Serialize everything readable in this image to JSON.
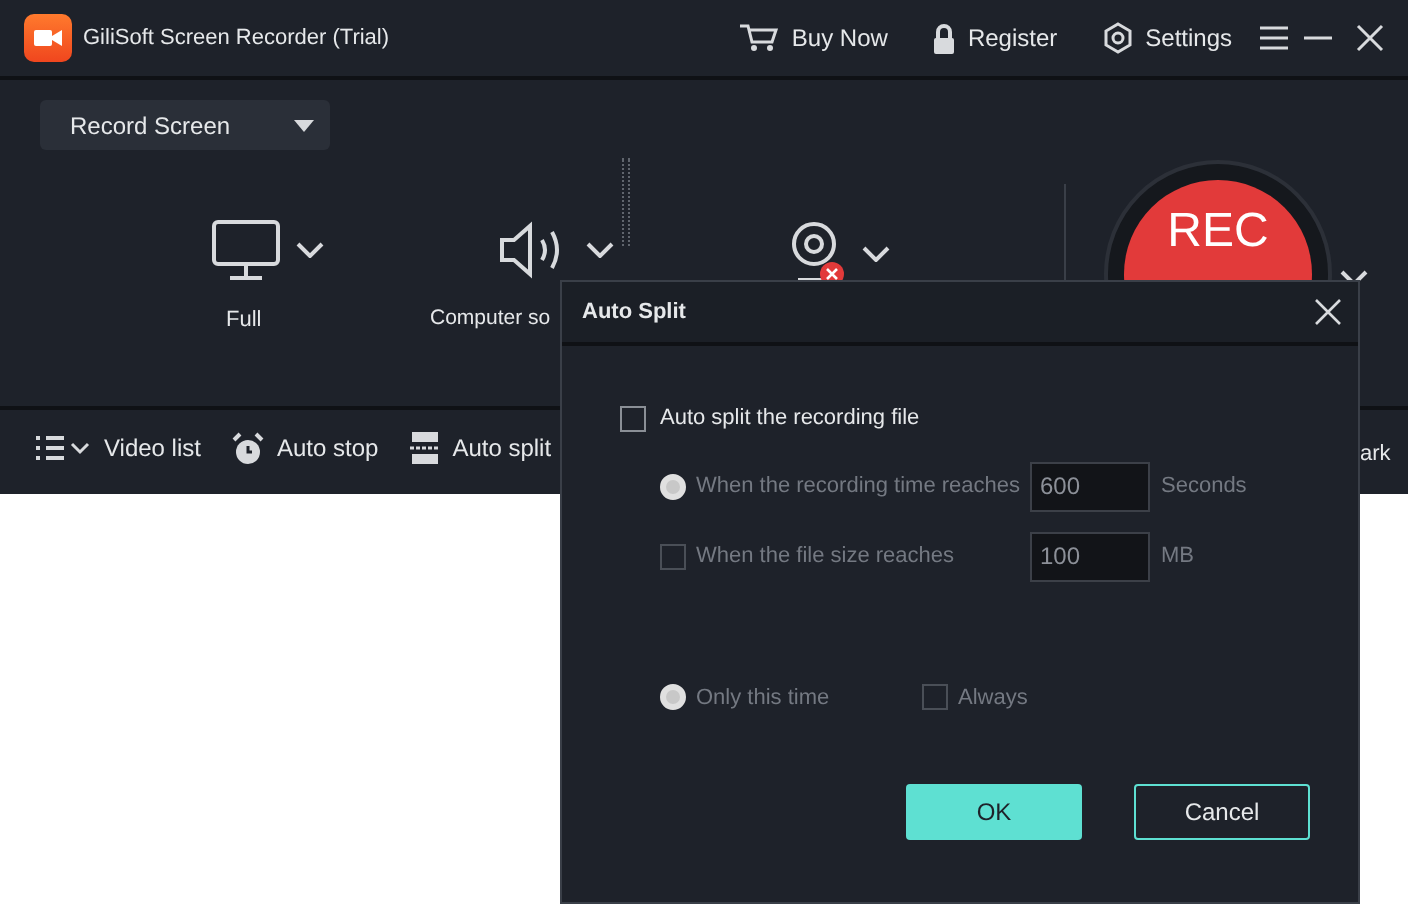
{
  "window": {
    "title": "GiliSoft Screen Recorder (Trial)"
  },
  "title_bar": {
    "links": [
      {
        "label": "Buy Now",
        "kind": "cart"
      },
      {
        "label": "Register",
        "kind": "lock"
      },
      {
        "label": "Settings",
        "kind": "gear"
      }
    ]
  },
  "mode_dropdown": {
    "value": "Record Screen"
  },
  "sources": [
    {
      "kind": "screen",
      "label": "Full"
    },
    {
      "kind": "audio",
      "label": "Computer so"
    },
    {
      "kind": "webcam",
      "disabled": true
    }
  ],
  "record_button": {
    "label": "REC"
  },
  "toolbar": [
    {
      "kind": "list",
      "label": "Video list"
    },
    {
      "kind": "clock",
      "label": "Auto stop"
    },
    {
      "kind": "split",
      "label": "Auto split"
    },
    {
      "kind": "text",
      "label": "ark"
    }
  ],
  "dialog": {
    "title": "Auto Split",
    "options_disabled": true,
    "enable": {
      "label": "Auto split the recording file",
      "checked": false
    },
    "conditions": [
      {
        "kind": "radio",
        "label": "When the recording time reaches",
        "selected": true,
        "value": "600",
        "unit": "Seconds"
      },
      {
        "kind": "checkbox",
        "label": "When the file size reaches",
        "checked": false,
        "value": "100",
        "unit": "MB"
      }
    ],
    "scope": [
      {
        "kind": "radio",
        "label": "Only this time",
        "selected": true
      },
      {
        "kind": "checkbox",
        "label": "Always",
        "checked": false
      }
    ],
    "buttons": [
      {
        "label": "OK",
        "kind": "primary"
      },
      {
        "label": "Cancel",
        "kind": "secondary"
      }
    ]
  }
}
